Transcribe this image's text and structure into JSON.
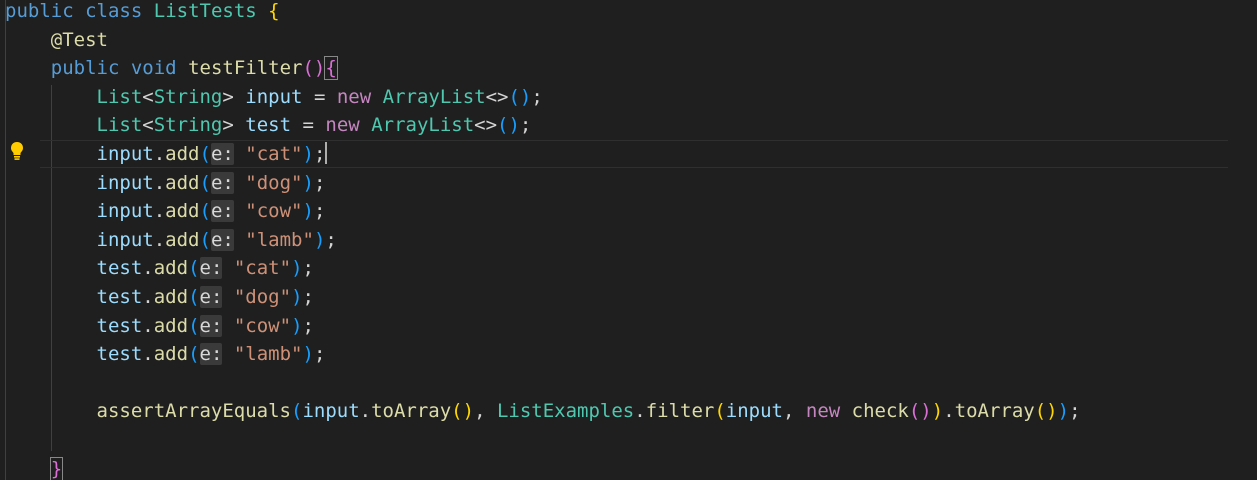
{
  "code": {
    "class_kw1": "public",
    "class_kw2": "class",
    "class_name": "ListTests",
    "open_brace": "{",
    "annotation": "@Test",
    "method_kw1": "public",
    "method_kw2": "void",
    "method_name": "testFilter",
    "list_type": "List",
    "generic_type": "String",
    "var_input": "input",
    "var_test": "test",
    "new_kw": "new",
    "arraylist_type": "ArrayList",
    "add_method": "add",
    "param_hint": "e:",
    "values": [
      "\"cat\"",
      "\"dog\"",
      "\"cow\"",
      "\"lamb\""
    ],
    "assert_fn": "assertArrayEquals",
    "toarray_fn": "toArray",
    "list_examples": "ListExamples",
    "filter_fn": "filter",
    "check_fn": "check",
    "close_brace": "}"
  },
  "icons": {
    "lightbulb": "lightbulb-icon"
  },
  "colors": {
    "background": "#1f1f1f",
    "keyword": "#569cd6",
    "control_keyword": "#c586c0",
    "type": "#4ec9b0",
    "function": "#dcdcaa",
    "variable": "#9cdcfe",
    "string": "#ce9178",
    "lightbulb": "#ffcc00"
  }
}
